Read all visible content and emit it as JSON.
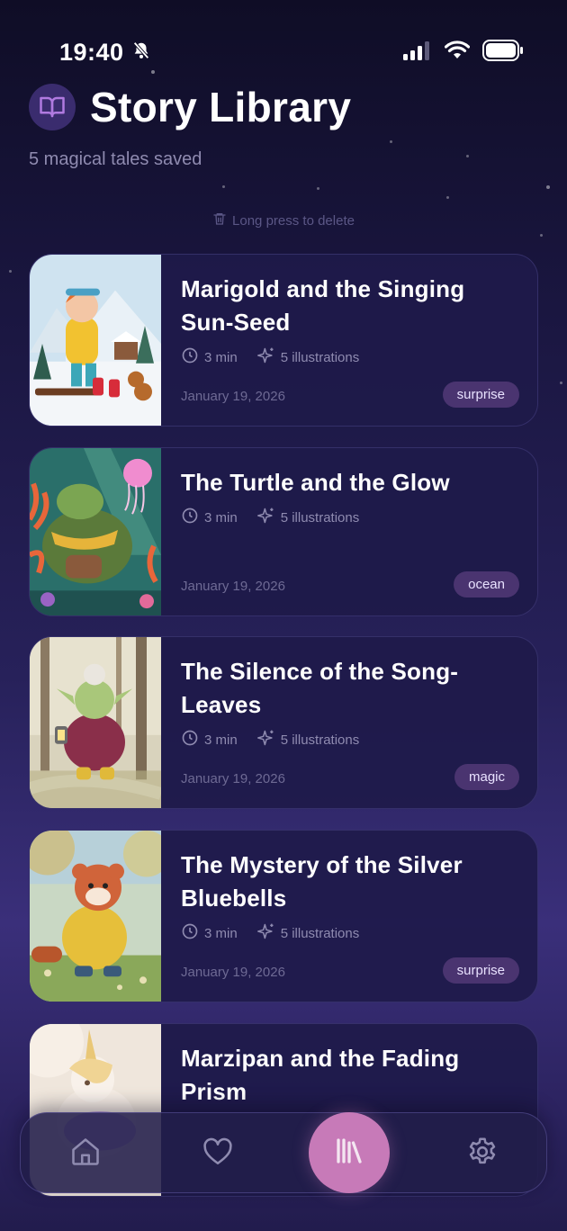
{
  "status_bar": {
    "time": "19:40"
  },
  "header": {
    "title": "Story Library",
    "subtitle": "5 magical tales saved",
    "hint": "Long press to delete"
  },
  "stories": [
    {
      "title": "Marigold and the Singing Sun-Seed",
      "duration": "3 min",
      "illustrations": "5 illustrations",
      "date": "January 19, 2026",
      "tag": "surprise"
    },
    {
      "title": "The Turtle and the Glow",
      "duration": "3 min",
      "illustrations": "5 illustrations",
      "date": "January 19, 2026",
      "tag": "ocean"
    },
    {
      "title": "The Silence of the Song-Leaves",
      "duration": "3 min",
      "illustrations": "5 illustrations",
      "date": "January 19, 2026",
      "tag": "magic"
    },
    {
      "title": "The Mystery of the Silver Bluebells",
      "duration": "3 min",
      "illustrations": "5 illustrations",
      "date": "January 19, 2026",
      "tag": "surprise"
    },
    {
      "title": "Marzipan and the Fading Prism"
    }
  ],
  "nav": {
    "items": [
      "home-icon",
      "heart-icon",
      "library-icon",
      "gear-icon"
    ],
    "active": "library"
  },
  "colors": {
    "accent": "#c77ab8",
    "tag_bg": "#4a3470",
    "background": "#1a1640"
  }
}
